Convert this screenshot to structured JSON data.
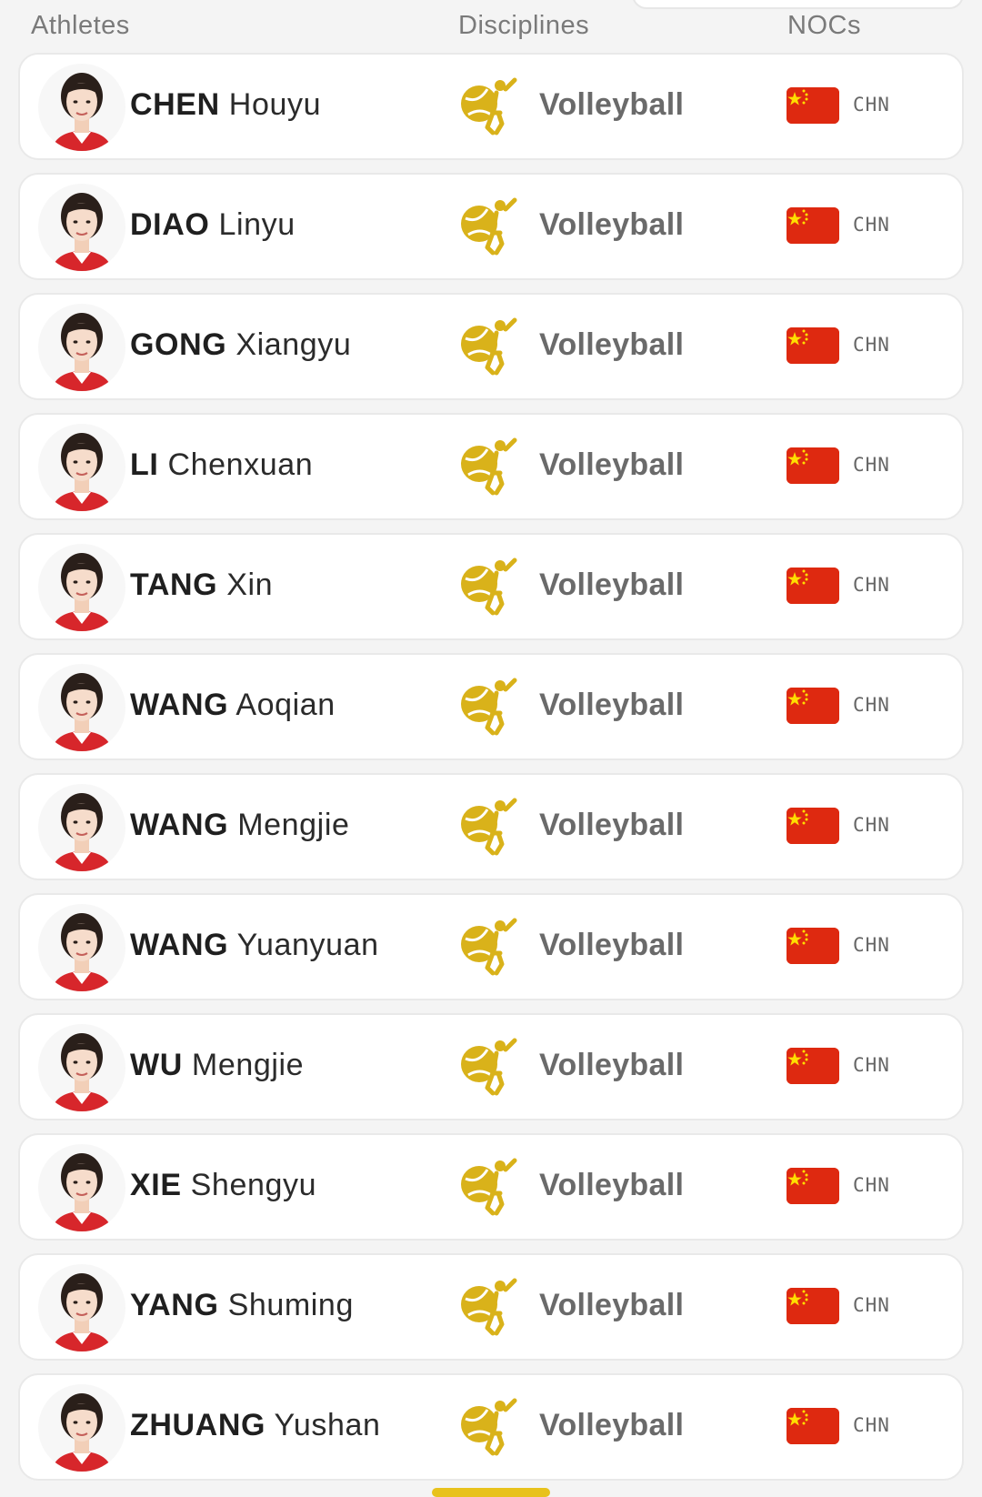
{
  "header": {
    "athletes_label": "Athletes",
    "disciplines_label": "Disciplines",
    "nocs_label": "NOCs"
  },
  "colors": {
    "sport_icon": "#d9b21a",
    "flag_red": "#de2910",
    "flag_star": "#ffde00",
    "uniform_red": "#d7262b"
  },
  "icons": {
    "sport": "volleyball-pictogram-icon",
    "flag": "china-flag-icon",
    "avatar": "athlete-portrait"
  },
  "athletes": [
    {
      "surname": "CHEN",
      "given": "Houyu",
      "discipline": "Volleyball",
      "noc": "CHN"
    },
    {
      "surname": "DIAO",
      "given": "Linyu",
      "discipline": "Volleyball",
      "noc": "CHN"
    },
    {
      "surname": "GONG",
      "given": "Xiangyu",
      "discipline": "Volleyball",
      "noc": "CHN"
    },
    {
      "surname": "LI",
      "given": "Chenxuan",
      "discipline": "Volleyball",
      "noc": "CHN"
    },
    {
      "surname": "TANG",
      "given": "Xin",
      "discipline": "Volleyball",
      "noc": "CHN"
    },
    {
      "surname": "WANG",
      "given": "Aoqian",
      "discipline": "Volleyball",
      "noc": "CHN"
    },
    {
      "surname": "WANG",
      "given": "Mengjie",
      "discipline": "Volleyball",
      "noc": "CHN"
    },
    {
      "surname": "WANG",
      "given": "Yuanyuan",
      "discipline": "Volleyball",
      "noc": "CHN"
    },
    {
      "surname": "WU",
      "given": "Mengjie",
      "discipline": "Volleyball",
      "noc": "CHN"
    },
    {
      "surname": "XIE",
      "given": "Shengyu",
      "discipline": "Volleyball",
      "noc": "CHN"
    },
    {
      "surname": "YANG",
      "given": "Shuming",
      "discipline": "Volleyball",
      "noc": "CHN"
    },
    {
      "surname": "ZHUANG",
      "given": "Yushan",
      "discipline": "Volleyball",
      "noc": "CHN"
    }
  ]
}
